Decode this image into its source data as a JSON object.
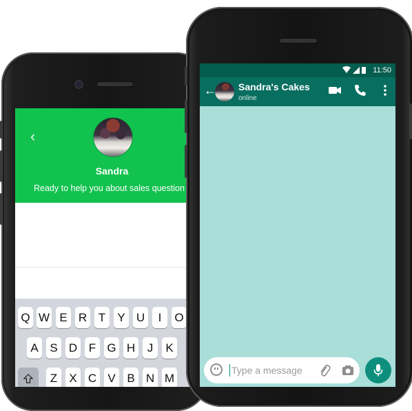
{
  "left_phone": {
    "agent_name": "Sandra",
    "tagline": "Ready to help you about sales question :",
    "back_icon": "chevron-left-icon",
    "avatar_icon": "cake-avatar",
    "keyboard": {
      "row1": [
        "Q",
        "W",
        "E",
        "R",
        "T",
        "Y",
        "U",
        "I",
        "O"
      ],
      "row2": [
        "A",
        "S",
        "D",
        "F",
        "G",
        "H",
        "J",
        "K"
      ],
      "row3": [
        "Z",
        "X",
        "C",
        "V",
        "B",
        "N",
        "M"
      ],
      "shift_icon": "shift-icon"
    },
    "colors": {
      "header": "#12c24f"
    }
  },
  "right_phone": {
    "status_bar": {
      "time": "11:50",
      "icons": [
        "wifi-icon",
        "signal-icon",
        "battery-icon"
      ]
    },
    "header": {
      "contact_name": "Sandra's Cakes",
      "status": "online",
      "icons": [
        "back-arrow-icon",
        "video-call-icon",
        "phone-call-icon",
        "more-icon"
      ]
    },
    "composer": {
      "placeholder": "Type a message",
      "icons": [
        "emoji-icon",
        "attach-icon",
        "camera-icon",
        "mic-icon"
      ]
    },
    "colors": {
      "status_bar": "#055d4f",
      "header": "#086e5f",
      "chat_bg": "#a9ded9",
      "mic": "#0e8f7d"
    }
  }
}
